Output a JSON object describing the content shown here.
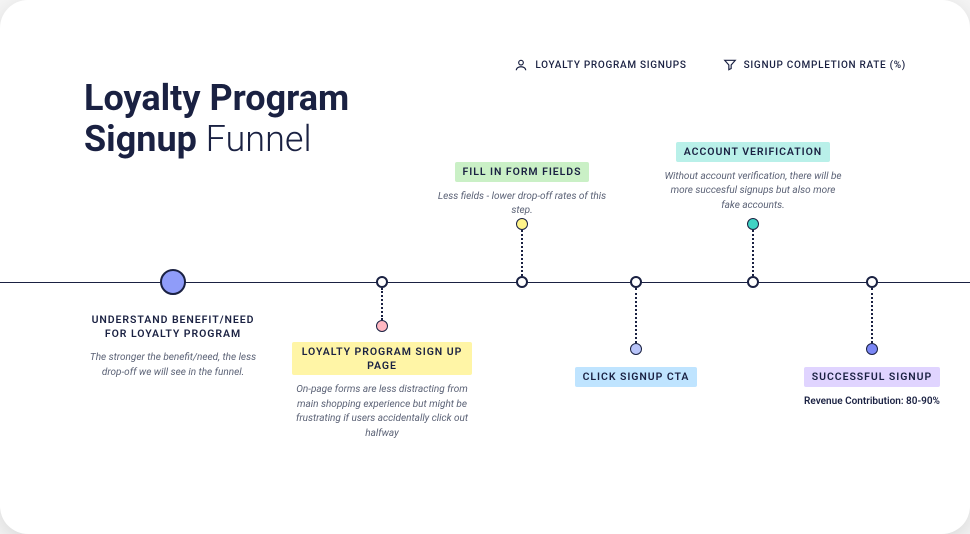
{
  "title": {
    "line1_bold": "Loyalty Program",
    "line2_bold": "Signup",
    "line2_light": " Funnel"
  },
  "legend": {
    "metric1": "LOYALTY PROGRAM SIGNUPS",
    "metric2": "SIGNUP COMPLETION RATE (%)"
  },
  "stages": [
    {
      "label": "UNDERSTAND BENEFIT/NEED FOR LOYALTY PROGRAM",
      "desc": "The stronger the benefit/need, the less drop-off we will see in the funnel."
    },
    {
      "label": "LOYALTY PROGRAM SIGN UP PAGE",
      "desc": "On-page forms are less distracting from main shopping experience but might be frustrating if users accidentally click out halfway"
    },
    {
      "label": "FILL IN FORM FIELDS",
      "desc": "Less fields - lower drop-off rates of this step."
    },
    {
      "label": "CLICK SIGNUP CTA",
      "desc": ""
    },
    {
      "label": "ACCOUNT VERIFICATION",
      "desc": "Without account verification, there will be more succesful signups but also more fake accounts."
    },
    {
      "label": "SUCCESSFUL SIGNUP",
      "desc": "Revenue Contribution: 80-90%"
    }
  ]
}
